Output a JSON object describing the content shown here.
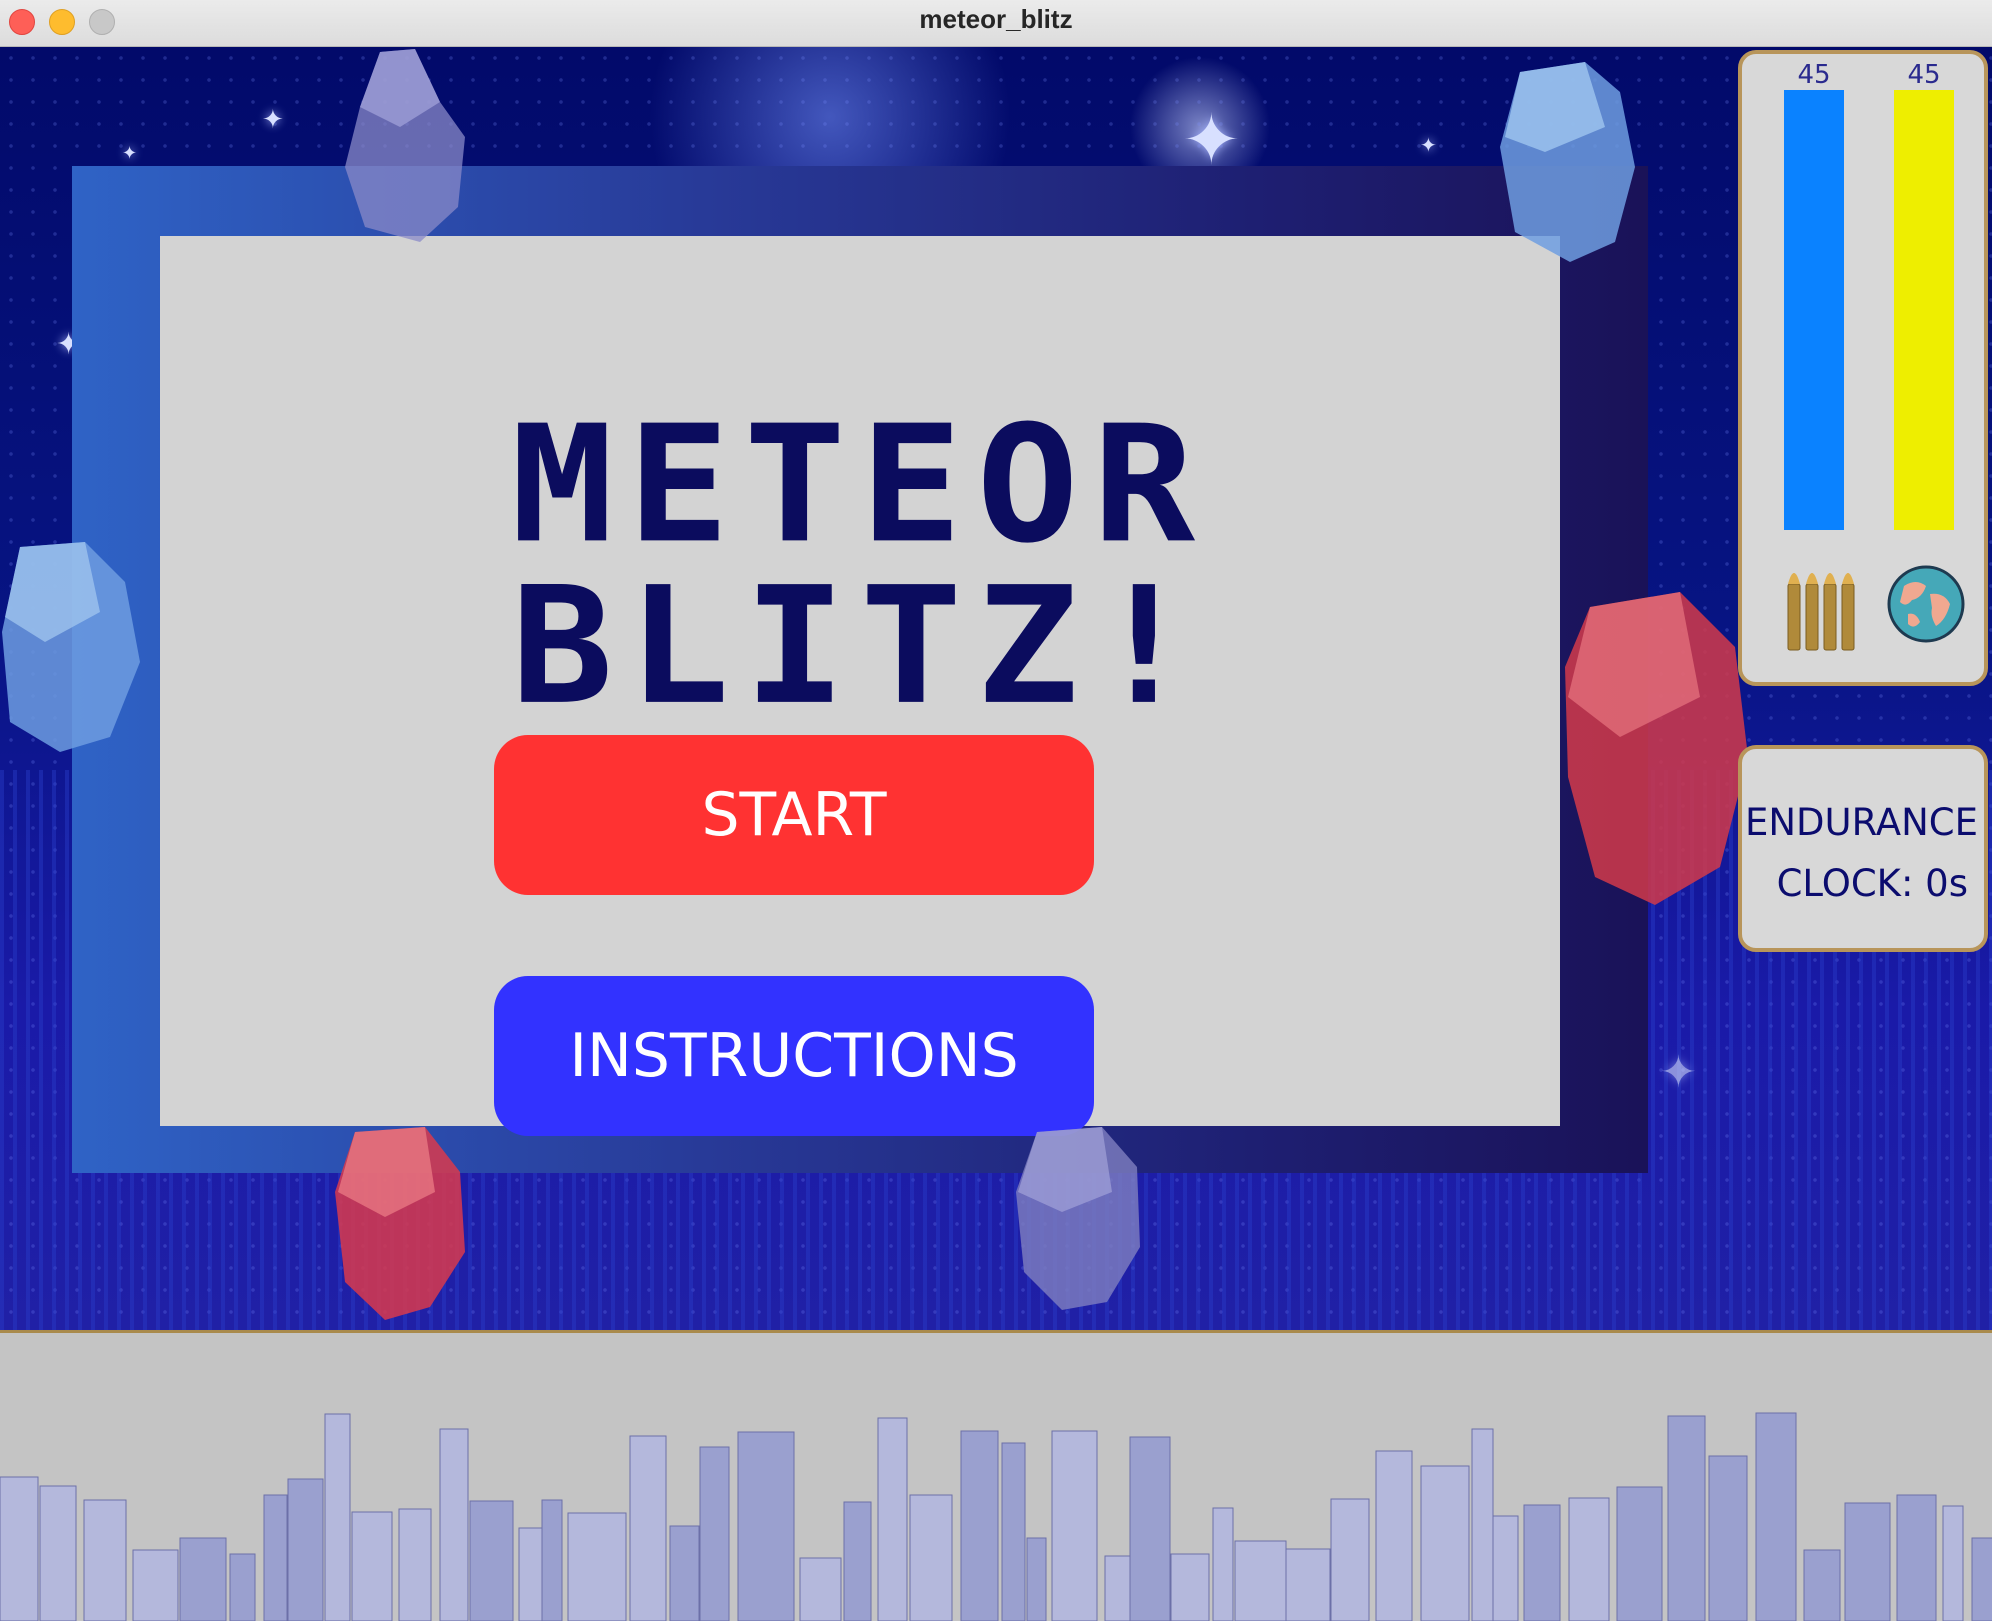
{
  "window": {
    "title": "meteor_blitz"
  },
  "menu": {
    "title": "METEOR BLITZ!",
    "start_label": "START",
    "instructions_label": "INSTRUCTIONS"
  },
  "hud": {
    "ammo_value": "45",
    "earth_value": "45",
    "ammo_color": "#0a82ff",
    "earth_color": "#eeee00",
    "ammo_fill": 1.0,
    "earth_fill": 1.0,
    "ammo_icon": "bullets-icon",
    "earth_icon": "earth-icon",
    "clock_line1": "ENDURANCE",
    "clock_line2": "CLOCK: 0s"
  },
  "colors": {
    "start_button": "#ff3232",
    "instructions_button": "#3232ff",
    "title_text": "#0b0c5e"
  }
}
